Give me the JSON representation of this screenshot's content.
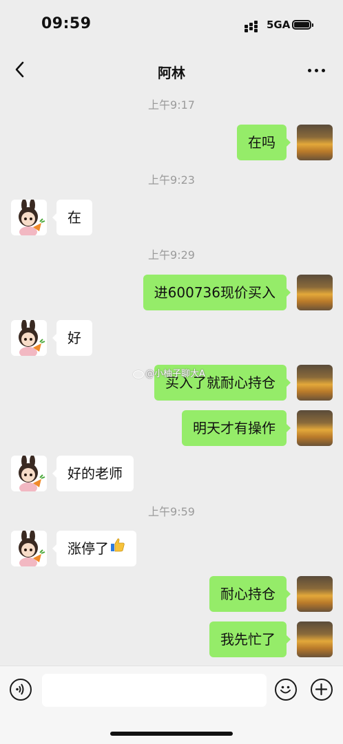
{
  "status_bar": {
    "time": "09:59",
    "network": "5GA"
  },
  "nav": {
    "title": "阿林"
  },
  "messages": [
    {
      "type": "time",
      "text": "上午9:17"
    },
    {
      "type": "msg",
      "from": "me",
      "text": "在吗"
    },
    {
      "type": "time",
      "text": "上午9:23"
    },
    {
      "type": "msg",
      "from": "them",
      "text": "在"
    },
    {
      "type": "time",
      "text": "上午9:29"
    },
    {
      "type": "msg",
      "from": "me",
      "text": "进600736现价买入"
    },
    {
      "type": "msg",
      "from": "them",
      "text": "好"
    },
    {
      "type": "msg",
      "from": "me",
      "text": "买入了就耐心持仓"
    },
    {
      "type": "msg",
      "from": "me",
      "text": "明天才有操作"
    },
    {
      "type": "msg",
      "from": "them",
      "text": "好的老师"
    },
    {
      "type": "time",
      "text": "上午9:59"
    },
    {
      "type": "msg",
      "from": "them",
      "text": "涨停了",
      "emoji": "thumbs-up-icon"
    },
    {
      "type": "msg",
      "from": "me",
      "text": "耐心持仓"
    },
    {
      "type": "msg",
      "from": "me",
      "text": "我先忙了"
    }
  ],
  "watermark": "@小柚子聊大A",
  "colors": {
    "background": "#ededed",
    "my_bubble": "#95ec69",
    "their_bubble": "#ffffff",
    "timestamp": "#9b9b9b"
  },
  "icons": {
    "back": "chevron-left-icon",
    "more": "more-dots-icon",
    "voice": "voice-icon",
    "emoji": "emoji-icon",
    "plus": "plus-icon"
  }
}
